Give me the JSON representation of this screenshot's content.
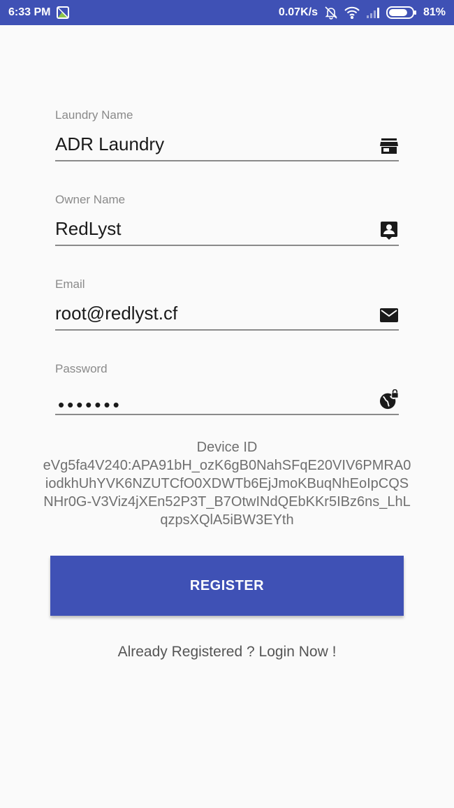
{
  "status_bar": {
    "time": "6:33 PM",
    "network_speed": "0.07K/s",
    "battery_percent": "81%",
    "battery_level": 0.81,
    "icons": [
      "gallery-icon",
      "mute-icon",
      "wifi-icon",
      "signal-icon",
      "battery-icon"
    ]
  },
  "form": {
    "laundry_name": {
      "label": "Laundry Name",
      "value": "ADR Laundry",
      "icon": "store-icon"
    },
    "owner_name": {
      "label": "Owner Name",
      "value": "RedLyst",
      "icon": "contact-icon"
    },
    "email": {
      "label": "Email",
      "value": "root@redlyst.cf",
      "icon": "mail-icon"
    },
    "password": {
      "label": "Password",
      "value": "•••••••",
      "icon": "vpn-lock-icon"
    }
  },
  "device": {
    "label": "Device ID",
    "id": "eVg5fa4V240:APA91bH_ozK6gB0NahSFqE20VIV6PMRA0iodkhUhYVK6NZUTCfO0XDWTb6EjJmoKBuqNhEoIpCQSNHr0G-V3Viz4jXEn52P3T_B7OtwINdQEbKKr5IBz6ns_LhLqzpsXQlA5iBW3EYth"
  },
  "actions": {
    "register_label": "REGISTER",
    "login_link": "Already Registered ? Login Now !"
  },
  "colors": {
    "primary": "#3f51b5",
    "background": "#fafafa",
    "label_gray": "#8a8a8a"
  }
}
